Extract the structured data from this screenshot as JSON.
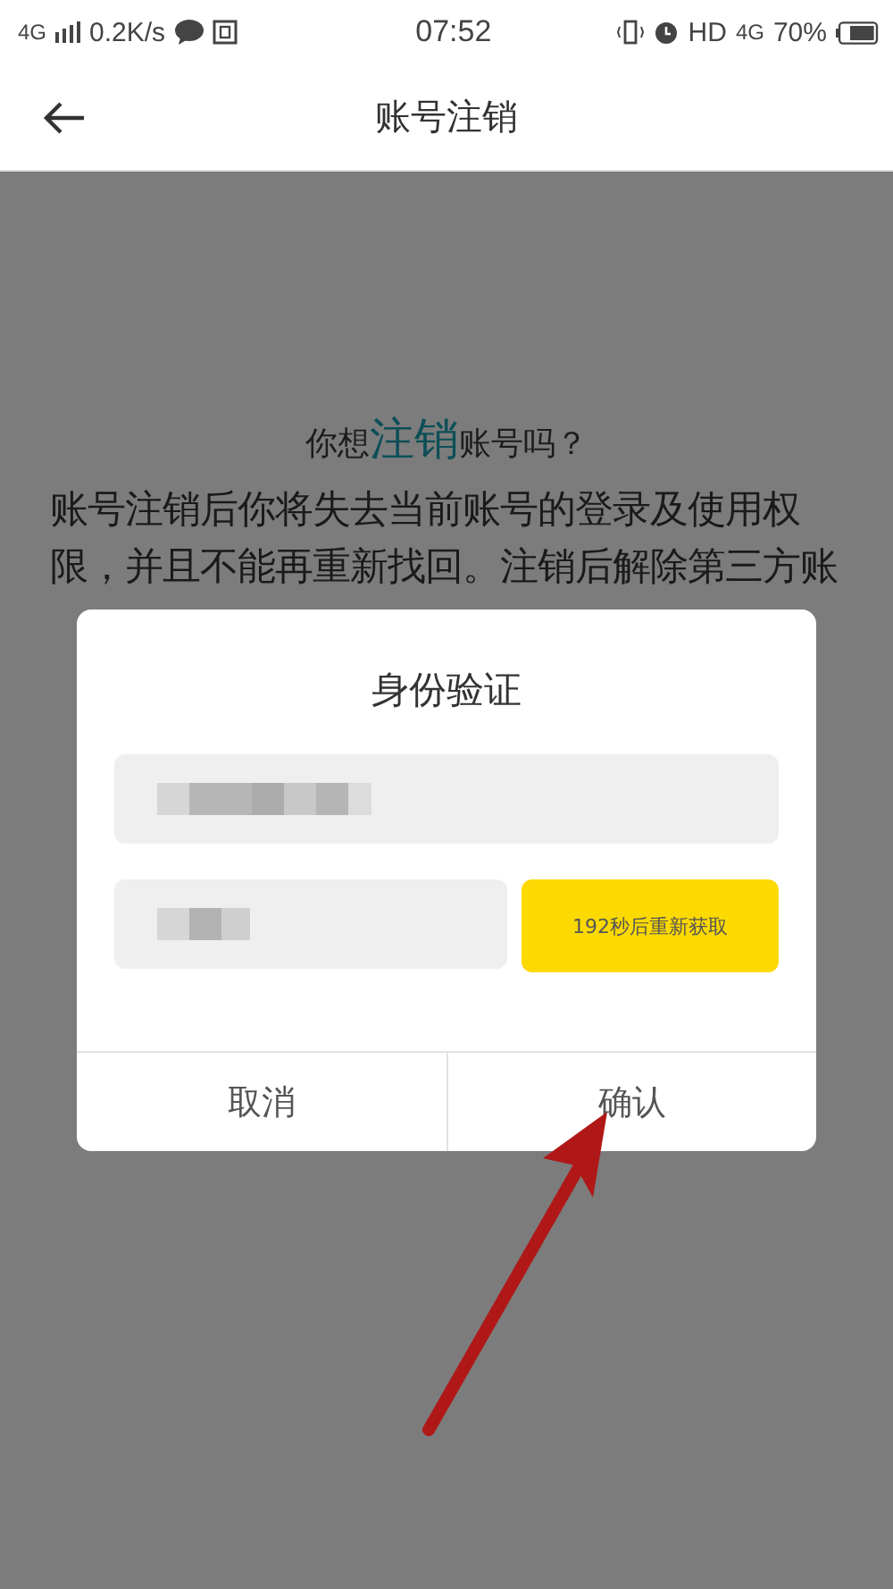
{
  "status_bar": {
    "network": "4G",
    "speed": "0.2K/s",
    "time": "07:52",
    "hd": "HD",
    "network_right": "4G",
    "battery": "70%"
  },
  "header": {
    "title": "账号注销"
  },
  "heading": {
    "before": "你想",
    "emphasis": "注销",
    "after": "账号吗？"
  },
  "notice": "账号注销后你将失去当前账号的登录及使用权限，并且不能再重新找回。注销后解除第三方账",
  "dialog": {
    "title": "身份验证",
    "code_button": "192秒后重新获取",
    "buttons": [
      "取消",
      "确认"
    ]
  }
}
